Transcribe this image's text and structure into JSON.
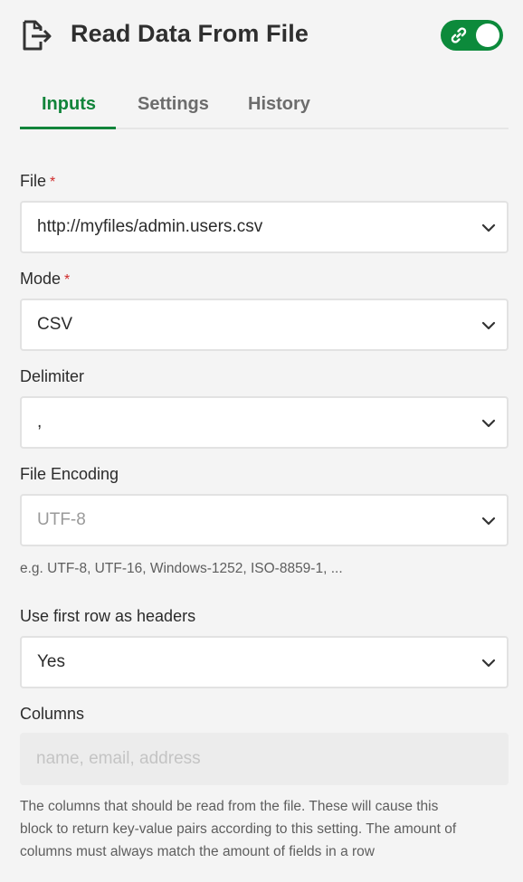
{
  "header": {
    "title": "Read Data From File",
    "toggle_enabled": true,
    "accent_color": "#0c8a3b"
  },
  "tabs": [
    {
      "label": "Inputs",
      "active": true
    },
    {
      "label": "Settings",
      "active": false
    },
    {
      "label": "History",
      "active": false
    }
  ],
  "fields": {
    "file": {
      "label": "File",
      "required_mark": "*",
      "value": "http://myfiles/admin.users.csv"
    },
    "mode": {
      "label": "Mode",
      "required_mark": "*",
      "value": "CSV"
    },
    "delimiter": {
      "label": "Delimiter",
      "value": ","
    },
    "encoding": {
      "label": "File Encoding",
      "placeholder": "UTF-8",
      "hint": "e.g. UTF-8, UTF-16, Windows-1252, ISO-8859-1, ..."
    },
    "headers": {
      "label": "Use first row as headers",
      "value": "Yes"
    },
    "columns": {
      "label": "Columns",
      "placeholder": "name, email, address",
      "hint_lines": [
        "The columns that should be read from the file. These will cause this",
        "block to return key-value pairs according to this setting. The amount of",
        "columns must always match the amount of fields in a row"
      ]
    }
  },
  "icons": {
    "header_icon": "file-export-icon",
    "toggle_icon": "link-icon",
    "select_icon": "chevron-down-icon"
  }
}
